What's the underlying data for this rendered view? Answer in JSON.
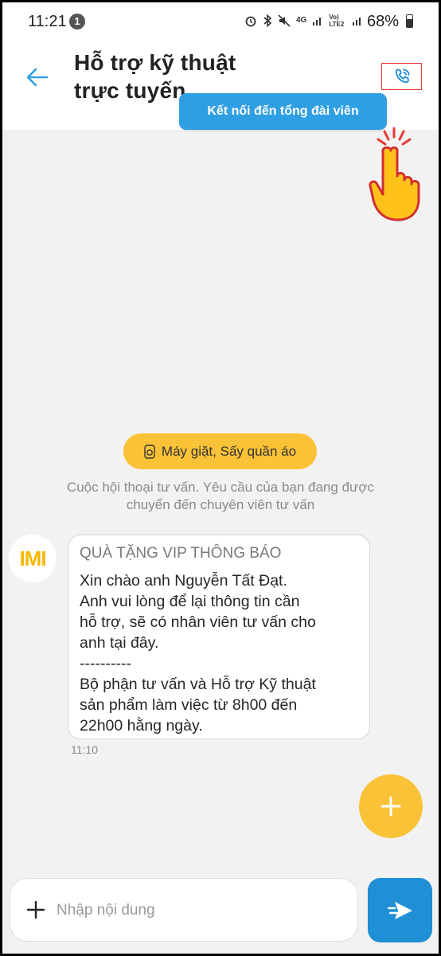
{
  "status_bar": {
    "time": "11:21",
    "notification_count": "1",
    "network_label": "4G",
    "volte_label": "Vo) LTE2",
    "battery": "68%"
  },
  "header": {
    "title_line1": "Hỗ trợ kỹ thuật",
    "title_line2": "trực tuyến",
    "back_icon": "arrow-left-icon",
    "call_icon": "phone-call-icon",
    "tooltip": "Kết nối đến tổng đài viên"
  },
  "chat": {
    "category_chip": "Máy giặt, Sấy quần áo",
    "category_icon": "washing-machine-icon",
    "system_text_line1": "Cuộc hội thoại tư vấn. Yêu cầu của bạn đang được",
    "system_text_line2": "chuyển đến chuyên viên tư vấn",
    "avatar_text": "IMI",
    "message": {
      "header": "QUÀ TẶNG VIP THÔNG BÁO",
      "lines": [
        "Xin chào anh Nguyễn Tất Đạt.",
        "Anh vui lòng để lại thông tin cần",
        "hỗ trợ, sẽ có nhân viên tư vấn cho",
        "anh tại đây.",
        "----------",
        "Bộ phận tư vấn và Hỗ trợ Kỹ thuật",
        "sản phẩm làm việc từ 8h00 đến",
        "22h00 hằng ngày."
      ],
      "time": "11:10"
    },
    "fab_icon": "plus-icon"
  },
  "composer": {
    "placeholder": "Nhập nội dung",
    "value": "",
    "send_icon": "send-icon"
  },
  "colors": {
    "accent_blue": "#2f9fe3",
    "yellow": "#f9c237",
    "highlight_red": "#e53935"
  }
}
